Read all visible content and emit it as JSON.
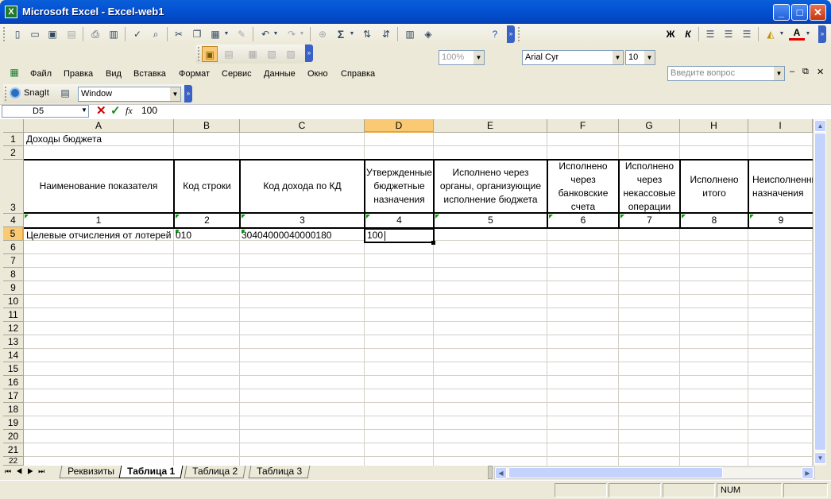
{
  "window": {
    "title": "Microsoft Excel - Excel-web1",
    "app_icon": "excel-icon"
  },
  "toolbar": {
    "zoom": "100%",
    "font_name": "Arial Cyr",
    "font_size": "10",
    "bold_label": "Ж",
    "italic_label": "К",
    "sum_label": "Σ"
  },
  "menu": {
    "items": [
      "Файл",
      "Правка",
      "Вид",
      "Вставка",
      "Формат",
      "Сервис",
      "Данные",
      "Окно",
      "Справка"
    ],
    "help_placeholder": "Введите вопрос"
  },
  "snagit": {
    "label": "SnagIt",
    "capture_mode": "Window"
  },
  "formula_bar": {
    "cell_ref": "D5",
    "value": "100",
    "fx": "fx"
  },
  "sheet": {
    "columns": [
      "A",
      "B",
      "C",
      "D",
      "E",
      "F",
      "G",
      "H",
      "I"
    ],
    "selected_column": "D",
    "rows": [
      "1",
      "2",
      "3",
      "4",
      "5",
      "6",
      "7",
      "8",
      "9",
      "10",
      "11",
      "12",
      "13",
      "14",
      "15",
      "16",
      "17",
      "18",
      "19",
      "20",
      "21",
      "22"
    ],
    "selected_row": "5",
    "a1": "Доходы бюджета",
    "headers": [
      "Наименование показателя",
      "Код строки",
      "Код дохода по КД",
      "Утвержденные бюджетные назначения",
      "Исполнено через органы, организующие исполнение бюджета",
      "Исполнено через банковские счета",
      "Исполнено через некассовые операции",
      "Исполнено итого",
      "Неисполненные назначения"
    ],
    "col_numbers": [
      "1",
      "2",
      "3",
      "4",
      "5",
      "6",
      "7",
      "8",
      "9"
    ],
    "row5": {
      "a": "Целевые отчисления от лотерей",
      "b": "010",
      "c": "30404000040000180",
      "d": "100"
    }
  },
  "tabs": {
    "items": [
      "Реквизиты",
      "Таблица 1",
      "Таблица 2",
      "Таблица 3"
    ],
    "active": "Таблица 1"
  },
  "status": {
    "num": "NUM"
  }
}
